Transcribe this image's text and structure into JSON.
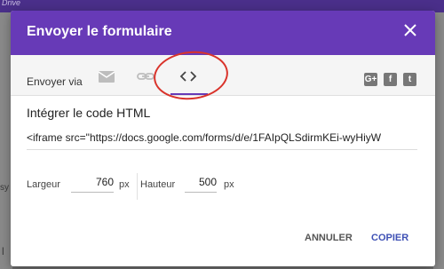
{
  "backdrop": {
    "drive_label": "Drive",
    "side_left": "sy",
    "side_bottom": "l"
  },
  "dialog": {
    "title": "Envoyer le formulaire",
    "close_icon": "close-icon",
    "send_via_label": "Envoyer via",
    "tabs": [
      {
        "icon": "email-icon",
        "active": false
      },
      {
        "icon": "link-icon",
        "active": false
      },
      {
        "icon": "code-icon",
        "active": true
      }
    ],
    "social": [
      {
        "icon": "google-plus-icon",
        "label": "G+"
      },
      {
        "icon": "facebook-icon",
        "label": "f"
      },
      {
        "icon": "twitter-icon",
        "label": "t"
      }
    ],
    "embed": {
      "title": "Intégrer le code HTML",
      "code": "<iframe src=\"https://docs.google.com/forms/d/e/1FAIpQLSdirmKEi-wyHiyW"
    },
    "width": {
      "label": "Largeur",
      "value": "760",
      "unit": "px"
    },
    "height": {
      "label": "Hauteur",
      "value": "500",
      "unit": "px"
    },
    "buttons": {
      "cancel": "ANNULER",
      "copy": "COPIER"
    },
    "colors": {
      "primary": "#673ab7",
      "accent": "#3f51b5",
      "annotation": "#d9332b"
    }
  }
}
